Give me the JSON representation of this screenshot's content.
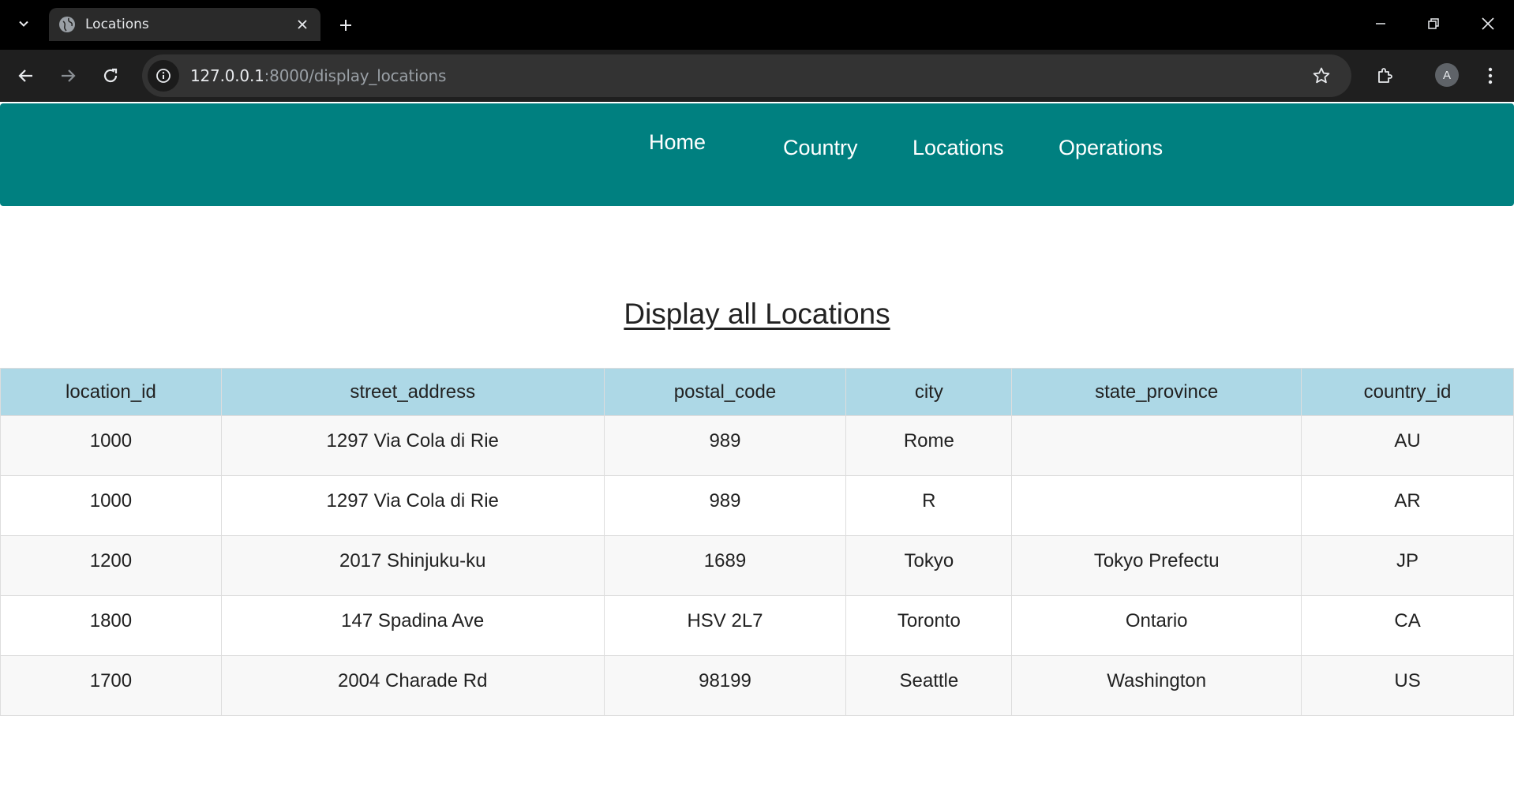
{
  "browser": {
    "tab_title": "Locations",
    "url_host": "127.0.0.1",
    "url_rest": ":8000/display_locations",
    "avatar_letter": "A"
  },
  "nav": {
    "home": "Home",
    "country": "Country",
    "locations": "Locations",
    "operations": "Operations"
  },
  "page": {
    "title": "Display all Locations"
  },
  "table": {
    "headers": [
      "location_id",
      "street_address",
      "postal_code",
      "city",
      "state_province",
      "country_id"
    ],
    "rows": [
      [
        "1000",
        "1297 Via Cola di Rie",
        "989",
        "Rome",
        "",
        "AU"
      ],
      [
        "1000",
        "1297 Via Cola di Rie",
        "989",
        "R",
        "",
        "AR"
      ],
      [
        "1200",
        "2017 Shinjuku-ku",
        "1689",
        "Tokyo",
        "Tokyo Prefectu",
        "JP"
      ],
      [
        "1800",
        "147 Spadina Ave",
        "HSV 2L7",
        "Toronto",
        "Ontario",
        "CA"
      ],
      [
        "1700",
        "2004 Charade Rd",
        "98199",
        "Seattle",
        "Washington",
        "US"
      ]
    ]
  },
  "colors": {
    "navbar": "#008080",
    "table_header": "#add8e6"
  }
}
